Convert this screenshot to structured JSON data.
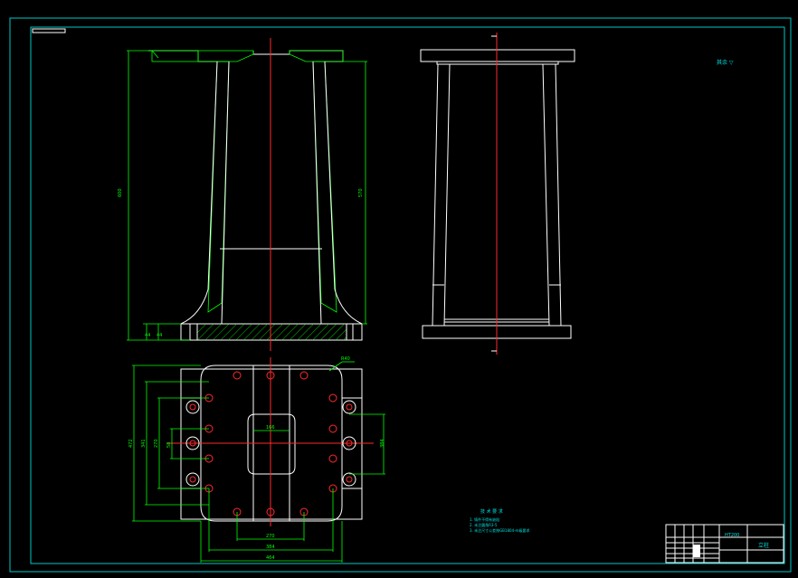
{
  "title_block": {
    "material": "HT200",
    "part_name": "立柱"
  },
  "notes": {
    "heading": "技 术 要 求",
    "items": [
      "1. 铸件不得有缺陷",
      "2. 未注圆角R3-5",
      "3. 未注尺寸公差按GB1804-m级要求"
    ]
  },
  "roughness_note": "其余 ▽",
  "dimensions": {
    "front_left_height": "600",
    "front_right_height": "570",
    "front_base_a": "44",
    "front_base_b": "44",
    "plan_overall_height": "472",
    "plan_inner_height": "341",
    "plan_inner2": "270",
    "plan_inner3": "58",
    "plan_right": "384",
    "plan_bottom_1": "270",
    "plan_bottom_2": "384",
    "plan_bottom_3": "464",
    "plan_top_center": "166",
    "plan_corner_label": "R40"
  },
  "colors": {
    "background": "#000000",
    "outline": "#ffffff",
    "dimension": "#00ff00",
    "centerline": "#ff2a2a",
    "frame": "#00c8c8"
  }
}
